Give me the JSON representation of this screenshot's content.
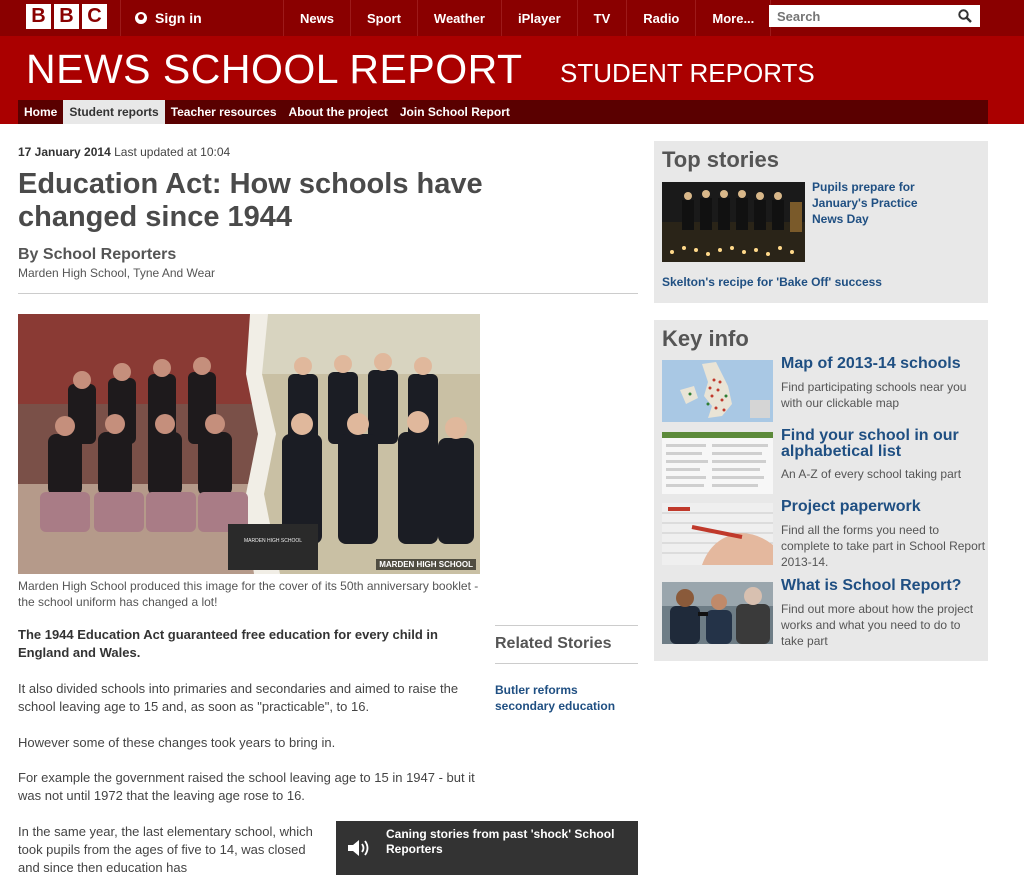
{
  "global": {
    "logo_letters": [
      "B",
      "B",
      "C"
    ],
    "signin_label": "Sign in",
    "nav": [
      "News",
      "Sport",
      "Weather",
      "iPlayer",
      "TV",
      "Radio",
      "More..."
    ],
    "search_placeholder": "Search"
  },
  "masthead": {
    "title": "NEWS SCHOOL REPORT",
    "subtitle": "STUDENT REPORTS",
    "section_nav": [
      "Home",
      "Student reports",
      "Teacher resources",
      "About the project",
      "Join School Report"
    ],
    "active_section": "Student reports"
  },
  "article": {
    "date": "17 January 2014",
    "updated": "Last updated at 10:04",
    "headline": "Education Act: How schools have changed since 1944",
    "byline": "By School Reporters",
    "school": "Marden High School, Tyne And Wear",
    "photo_credit": "MARDEN HIGH SCHOOL",
    "photo_sign": "MARDEN HIGH SCHOOL",
    "caption": "Marden High School produced this image for the cover of its 50th anniversary booklet - the school uniform has changed a lot!",
    "lede": "The 1944 Education Act guaranteed free education for every child in England and Wales.",
    "paragraphs": [
      "It also divided schools into primaries and secondaries and aimed to raise the school leaving age to 15 and, as soon as \"practicable\", to 16.",
      "However some of these changes took years to bring in.",
      "For example the government raised the school leaving age to 15 in 1947 - but it was not until 1972 that the leaving age rose to 16.",
      "In the same year, the last elementary school, which took pupils from the ages of five to 14, was closed and since then education has"
    ],
    "related_heading": "Related Stories",
    "related_link": "Butler reforms secondary education",
    "audio_title": "Caning stories from past 'shock' School Reporters"
  },
  "sidebar": {
    "top_stories_heading": "Top stories",
    "top_story_1": "Pupils prepare for January's Practice News Day",
    "top_story_2": "Skelton's recipe for 'Bake Off' success",
    "key_info_heading": "Key info",
    "key_info": [
      {
        "title": "Map of 2013-14 schools",
        "desc": "Find participating schools near you with our clickable map"
      },
      {
        "title": "Find your school in our alphabetical list",
        "desc": "An A-Z of every school taking part"
      },
      {
        "title": "Project paperwork",
        "desc": "Find all the forms you need to complete to take part in School Report 2013-14."
      },
      {
        "title": "What is School Report?",
        "desc": "Find out more about how the project works and what you need to do to take part"
      }
    ]
  },
  "colors": {
    "global_bar": "#8a0000",
    "masthead": "#aa0000",
    "section_nav": "#5a0000",
    "link": "#1f4f82",
    "panel_bg": "#e8e8e8"
  }
}
